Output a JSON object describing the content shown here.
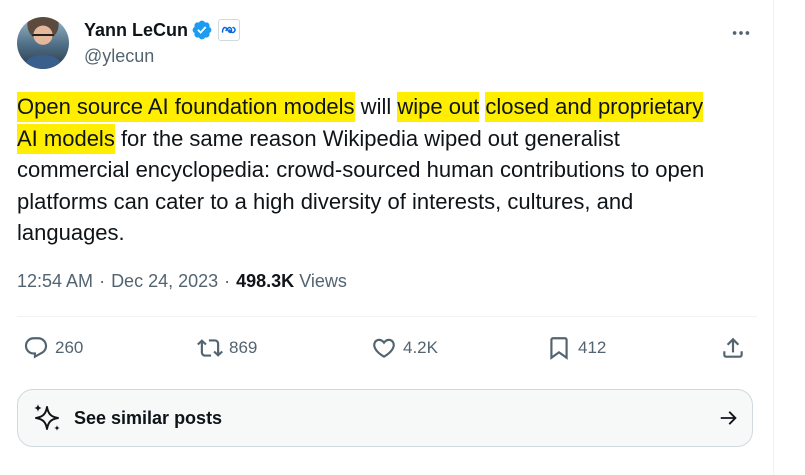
{
  "author": {
    "display_name": "Yann LeCun",
    "handle": "@ylecun",
    "verified": true,
    "affiliation_icon": "meta-logo-icon"
  },
  "tweet": {
    "lines": [
      [
        {
          "text": "Open source AI foundation models",
          "highlight": true
        },
        {
          "text": " will ",
          "highlight": false
        },
        {
          "text": "wipe out",
          "highlight": true
        },
        {
          "text": " ",
          "highlight": false
        },
        {
          "text": "closed and proprietary",
          "highlight": true
        }
      ],
      [
        {
          "text": "AI models",
          "highlight": true
        },
        {
          "text": " for the same reason Wikipedia wiped out generalist",
          "highlight": false
        }
      ],
      [
        {
          "text": "commercial encyclopedia: crowd-sourced human contributions to open",
          "highlight": false
        }
      ],
      [
        {
          "text": "platforms can cater to a high diversity of interests, cultures, and",
          "highlight": false
        }
      ],
      [
        {
          "text": "languages.",
          "highlight": false
        }
      ]
    ]
  },
  "meta": {
    "time": "12:54 AM",
    "separator": "·",
    "date": "Dec 24, 2023",
    "views_count": "498.3K",
    "views_label": "Views"
  },
  "actions": {
    "replies": "260",
    "reposts": "869",
    "likes": "4.2K",
    "bookmarks": "412"
  },
  "similar_posts": {
    "label": "See similar posts"
  },
  "colors": {
    "highlight": "#ffee00",
    "verified_blue": "#1d9bf0",
    "text_primary": "#0f1419",
    "text_secondary": "#536471",
    "meta_blue": "#0668e1"
  }
}
